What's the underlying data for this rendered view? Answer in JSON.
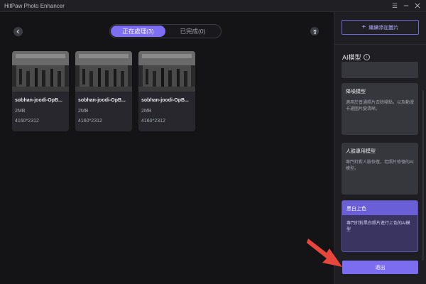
{
  "app": {
    "title": "HitPaw Photo Enhancer"
  },
  "tabs": [
    {
      "label": "正在處理(3)",
      "active": true
    },
    {
      "label": "已完成(0)",
      "active": false
    }
  ],
  "cards": [
    {
      "name": "sobhan-joodi-OpB...",
      "size": "2MB",
      "resolution": "4160*2312"
    },
    {
      "name": "sobhan-joodi-OpB...",
      "size": "2MB",
      "resolution": "4160*2312"
    },
    {
      "name": "sobhan-joodi-OpB...",
      "size": "2MB",
      "resolution": "4160*2312"
    }
  ],
  "sidebar": {
    "add_button_label": "繼續添加圖片",
    "ai_model_label": "AI模型",
    "models": [
      {
        "title": "降噪模型",
        "description": "適用於普通照片去除噪點，以及動漫卡通圖片變清晰。",
        "selected": false
      },
      {
        "title": "人臉專用模型",
        "description": "專門針對人臉恢復，老照片修復的AI模型。",
        "selected": false
      },
      {
        "title": "黑白上色",
        "description": "專門針對黑白照片進行上色的AI模型",
        "selected": true
      }
    ],
    "exit_button_label": "退出"
  },
  "colors": {
    "accent": "#7c6cf0",
    "background": "#151518",
    "panel": "#1e1e23"
  }
}
